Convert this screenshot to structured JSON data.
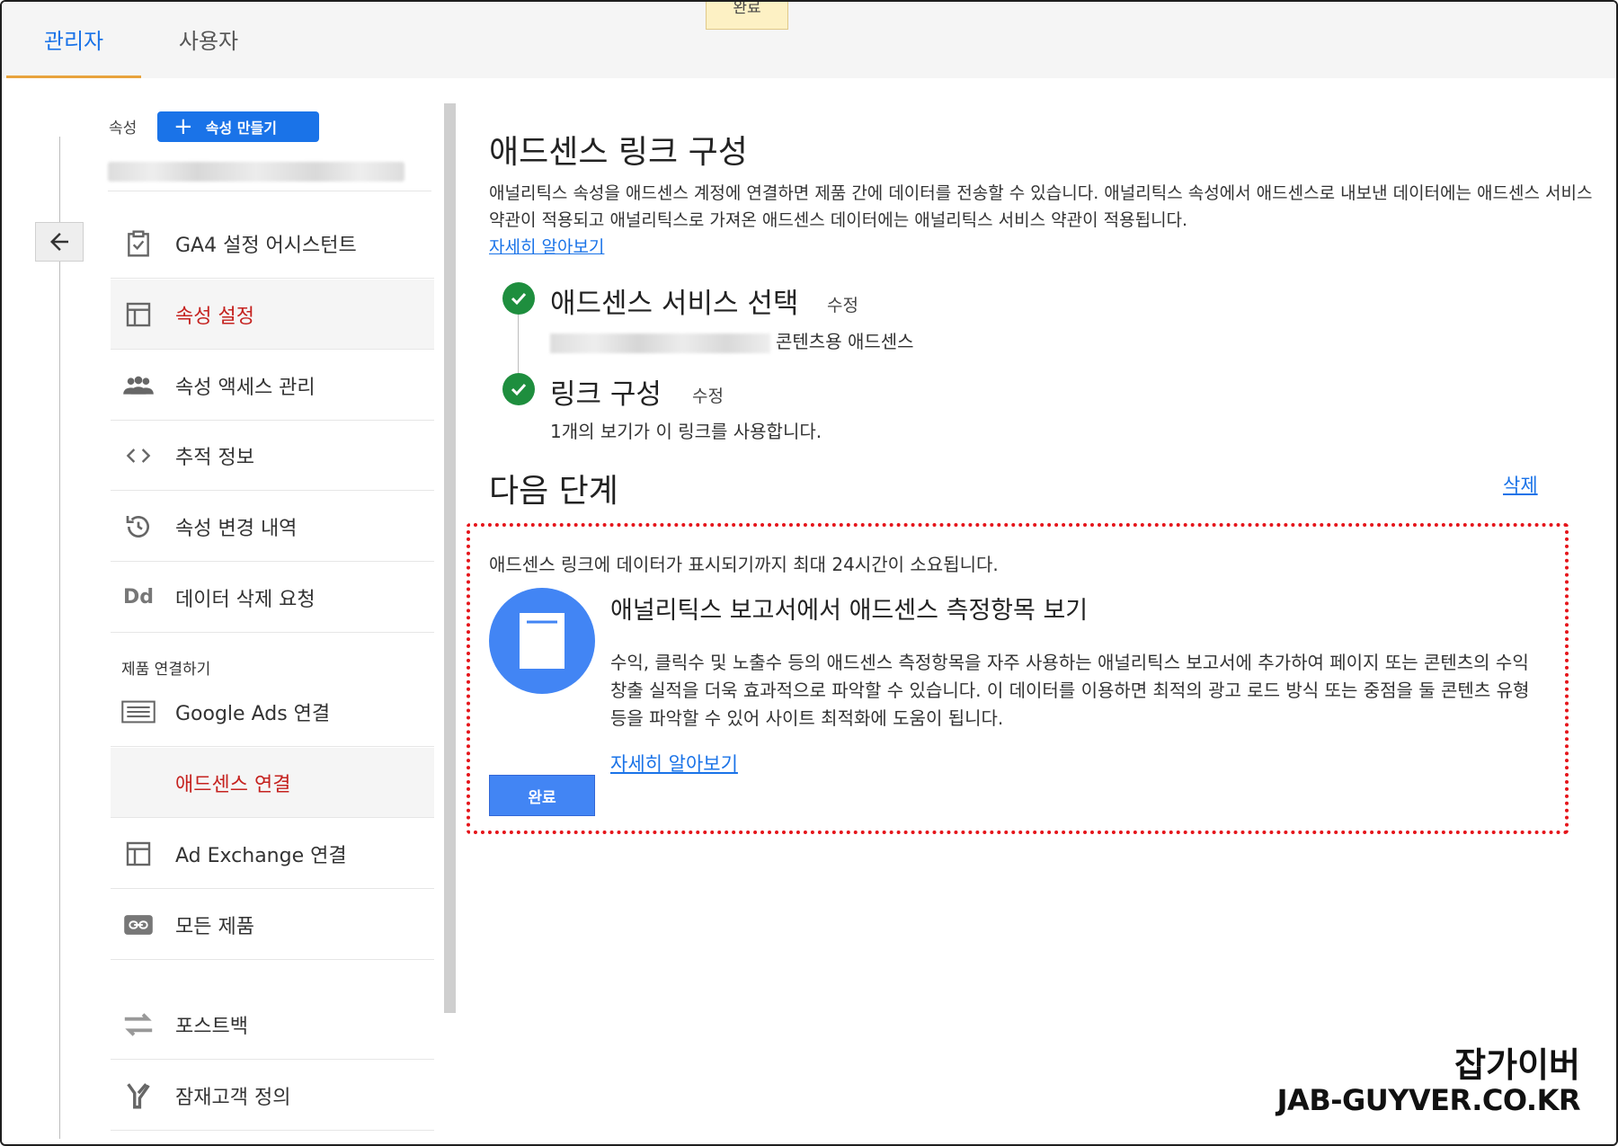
{
  "tabs": {
    "admin": "관리자",
    "user": "사용자"
  },
  "toast": "완료",
  "sidebar": {
    "property_label": "속성",
    "create_button": "속성 만들기",
    "items": [
      {
        "label": "GA4 설정 어시스턴트",
        "icon": "clipboard-check-icon"
      },
      {
        "label": "속성 설정",
        "icon": "layout-icon",
        "active": true
      },
      {
        "label": "속성 액세스 관리",
        "icon": "people-icon"
      },
      {
        "label": "추적 정보",
        "icon": "code-icon"
      },
      {
        "label": "속성 변경 내역",
        "icon": "history-icon"
      },
      {
        "label": "데이터 삭제 요청",
        "icon": "dd-icon"
      }
    ],
    "section_heading": "제품 연결하기",
    "product_items": [
      {
        "label": "Google Ads 연결",
        "icon": "ads-icon"
      },
      {
        "label": "애드센스 연결",
        "icon": "",
        "active": true
      },
      {
        "label": "Ad Exchange 연결",
        "icon": "layout-icon"
      },
      {
        "label": "모든 제품",
        "icon": "link-icon"
      },
      {
        "label": "포스트백",
        "icon": "postback-icon"
      },
      {
        "label": "잠재고객 정의",
        "icon": "audience-icon"
      }
    ]
  },
  "main": {
    "title": "애드센스 링크 구성",
    "description": "애널리틱스 속성을 애드센스 계정에 연결하면 제품 간에 데이터를 전송할 수 있습니다. 애널리틱스 속성에서 애드센스로 내보낸 데이터에는 애드센스 서비스 약관이 적용되고 애널리틱스로 가져온 애드센스 데이터에는 애널리틱스 서비스 약관이 적용됩니다.",
    "learn_more": "자세히 알아보기",
    "steps": [
      {
        "title": "애드센스 서비스 선택",
        "edit": "수정",
        "sub": "콘텐츠용 애드센스"
      },
      {
        "title": "링크 구성",
        "edit": "수정",
        "sub": "1개의 보기가 이 링크를 사용합니다."
      }
    ],
    "next_title": "다음 단계",
    "delete": "삭제",
    "notice": "애드센스 링크에 데이터가 표시되기까지 최대 24시간이 소요됩니다.",
    "card_title": "애널리틱스 보고서에서 애드센스 측정항목 보기",
    "card_body": "수익, 클릭수 및 노출수 등의 애드센스 측정항목을 자주 사용하는 애널리틱스 보고서에 추가하여 페이지 또는 콘텐츠의 수익 창출 실적을 더욱 효과적으로 파악할 수 있습니다. 이 데이터를 이용하면 최적의 광고 로드 방식 또는 중점을 둘 콘텐츠 유형 등을 파악할 수 있어 사이트 최적화에 도움이 됩니다.",
    "card_link": "자세히 알아보기",
    "done_button": "완료"
  },
  "watermark": {
    "line1": "잡가이버",
    "line2": "JAB-GUYVER.CO.KR"
  },
  "colors": {
    "accent": "#1a73e8",
    "active_red": "#c5221f",
    "highlight_border": "#e5141a",
    "check_green": "#1e8e3e"
  }
}
